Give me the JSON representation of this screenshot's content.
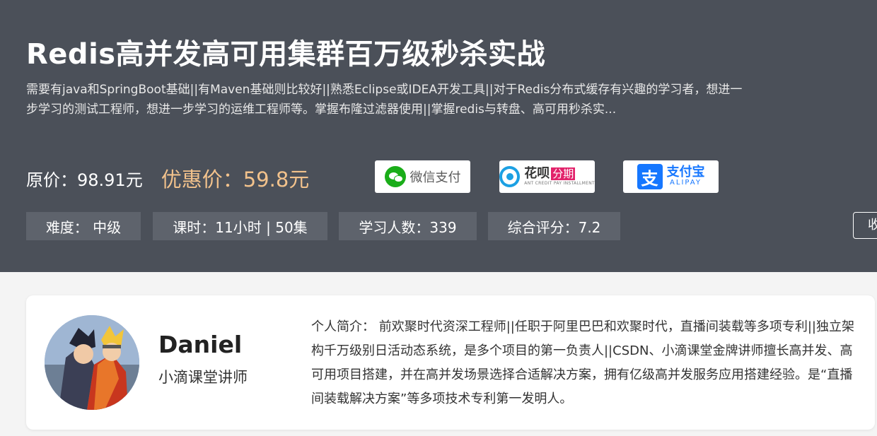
{
  "course": {
    "title": "Redis高并发高可用集群百万级秒杀实战",
    "description": "需要有java和SpringBoot基础||有Maven基础则比较好||熟悉Eclipse或IDEA开发工具||对于Redis分布式缓存有兴趣的学习者，想进一步学习的测试工程师，想进一步学习的运维工程师等。掌握布隆过滤器使用||掌握redis与转盘、高可用秒杀实..."
  },
  "pricing": {
    "original_label": "原价：98.91元",
    "sale_label": "优惠价：59.8元",
    "sale_color": "#f2c28c"
  },
  "payment": {
    "wechat_label": "微信支付",
    "huabei_label": "花呗",
    "huabei_installment": "分期",
    "huabei_sub": "ANT CREDIT PAY INSTALLMENT",
    "alipay_icon_char": "支",
    "alipay_label": "支付宝",
    "alipay_sub": "ALIPAY"
  },
  "stats": {
    "difficulty": "难度：  中级",
    "lessons": "课时：11小时 | 50集",
    "students": "学习人数：339",
    "rating": "综合评分：7.2"
  },
  "actions": {
    "collect_label": "收"
  },
  "teacher": {
    "name": "Daniel",
    "role": "小滴课堂讲师",
    "bio": "个人简介：  前欢聚时代资深工程师||任职于阿里巴巴和欢聚时代，直播间装载等多项专利||独立架构千万级别日活动态系统，是多个项目的第一负责人||CSDN、小滴课堂金牌讲师擅长高并发、高可用项目搭建，并在高并发场景选择合适解决方案，拥有亿级高并发服务应用搭建经验。是“直播间装载解决方案”等多项技术专利第一发明人。"
  },
  "colors": {
    "hero_bg": "#4b5059",
    "stat_bg": "#5e636c",
    "page_bg": "#f4f4f4",
    "wechat_green": "#1aad19",
    "huabei_blue": "#1ca0e3",
    "alipay_blue": "#1677ff"
  }
}
